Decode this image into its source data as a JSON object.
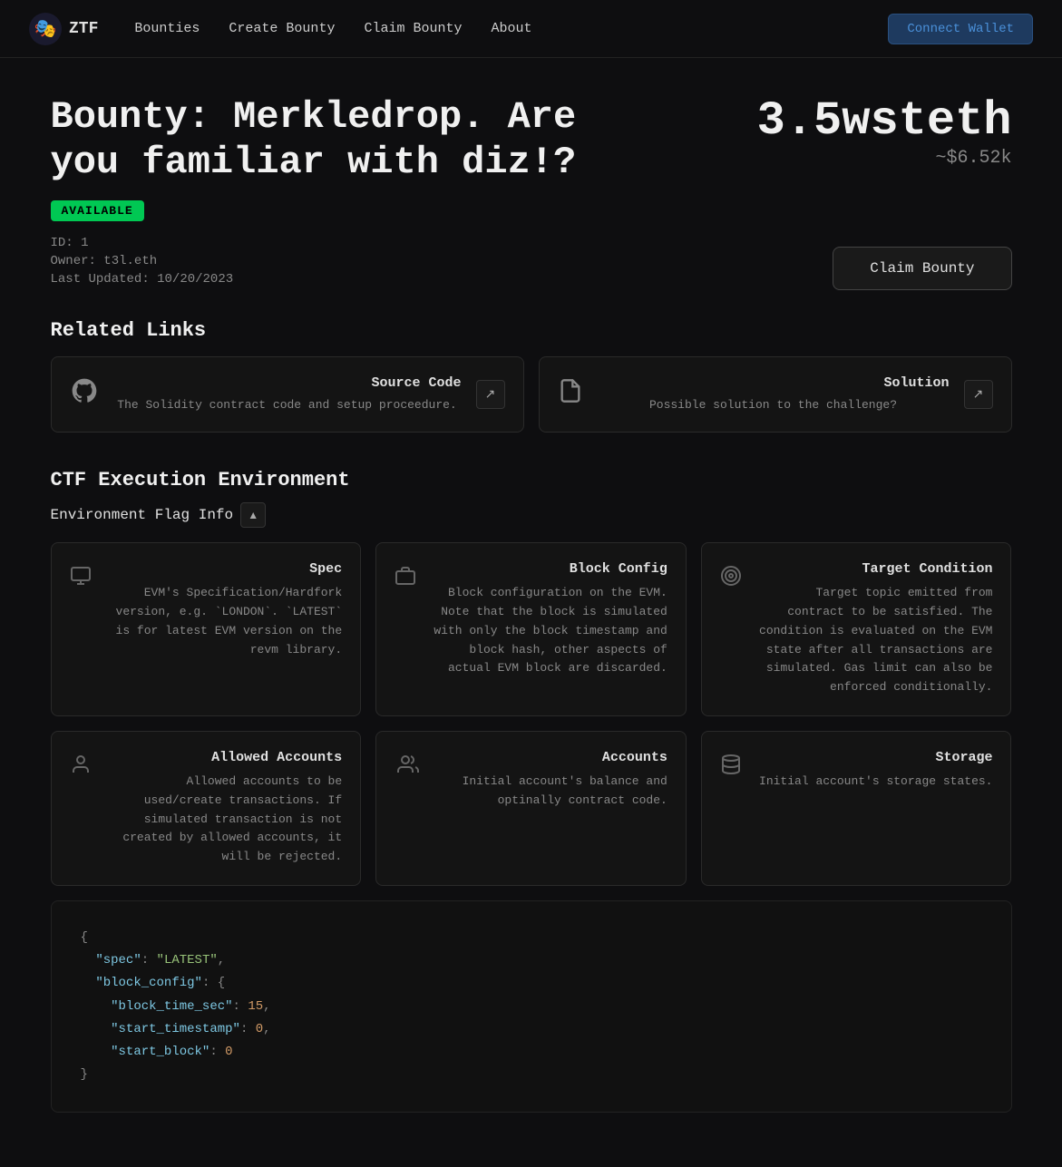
{
  "nav": {
    "logo_text": "ZTF",
    "logo_icon": "🎭",
    "links": [
      {
        "label": "Bounties",
        "id": "bounties"
      },
      {
        "label": "Create Bounty",
        "id": "create-bounty"
      },
      {
        "label": "Claim Bounty",
        "id": "claim-bounty"
      },
      {
        "label": "About",
        "id": "about"
      }
    ],
    "connect_wallet_label": "Connect Wallet"
  },
  "bounty": {
    "title": "Bounty: Merkledrop. Are you familiar with diz!?",
    "status": "AVAILABLE",
    "id": "ID: 1",
    "owner": "Owner: t3l.eth",
    "last_updated": "Last Updated: 10/20/2023",
    "reward_amount": "3.5wsteth",
    "reward_usd": "~$6.52k",
    "claim_button_label": "Claim Bounty"
  },
  "related_links": {
    "section_title": "Related Links",
    "cards": [
      {
        "id": "source-code",
        "icon": "github",
        "title": "Source Code",
        "description": "The Solidity contract code and setup proceedure.",
        "action_icon": "↗"
      },
      {
        "id": "solution",
        "icon": "doc",
        "title": "Solution",
        "description": "Possible solution to the challenge?",
        "action_icon": "↗"
      }
    ]
  },
  "ctf": {
    "section_title": "CTF Execution Environment",
    "env_flag_label": "Environment Flag Info",
    "chevron": "▲",
    "spec_cards": [
      {
        "id": "spec",
        "icon": "monitor",
        "title": "Spec",
        "description": "EVM's Specification/Hardfork version, e.g. `LONDON`. `LATEST` is for latest EVM version on the revm library."
      },
      {
        "id": "block-config",
        "icon": "block",
        "title": "Block Config",
        "description": "Block configuration on the EVM. Note that the block is simulated with only the block timestamp and block hash, other aspects of actual EVM block are discarded."
      },
      {
        "id": "target-condition",
        "icon": "target",
        "title": "Target Condition",
        "description": "Target topic emitted from contract to be satisfied. The condition is evaluated on the EVM state after all transactions are simulated. Gas limit can also be enforced conditionally."
      }
    ],
    "account_cards": [
      {
        "id": "allowed-accounts",
        "icon": "person",
        "title": "Allowed Accounts",
        "description": "Allowed accounts to be used/create transactions. If simulated transaction is not created by allowed accounts, it will be rejected."
      },
      {
        "id": "accounts",
        "icon": "group",
        "title": "Accounts",
        "description": "Initial account's balance and optinally contract code."
      },
      {
        "id": "storage",
        "icon": "storage",
        "title": "Storage",
        "description": "Initial account's storage states."
      }
    ],
    "code": {
      "lines": [
        {
          "type": "punct",
          "text": "{"
        },
        {
          "type": "key-str",
          "key": "\"spec\"",
          "colon": ": ",
          "value": "\"LATEST\"",
          "value_type": "str",
          "comma": ","
        },
        {
          "type": "key-obj",
          "key": "\"block_config\"",
          "colon": ": {"
        },
        {
          "type": "nested-key-num",
          "indent": "    ",
          "key": "\"block_time_sec\"",
          "colon": ": ",
          "value": "15",
          "comma": ","
        },
        {
          "type": "nested-key-num",
          "indent": "    ",
          "key": "\"start_timestamp\"",
          "colon": ": ",
          "value": "0",
          "comma": ","
        },
        {
          "type": "nested-key-num",
          "indent": "    ",
          "key": "\"start_block\"",
          "colon": ": ",
          "value": "0"
        },
        {
          "type": "punct",
          "text": "}"
        }
      ]
    }
  },
  "colors": {
    "available_bg": "#00c853",
    "available_text": "#000000",
    "accent_blue": "#4a90d9"
  }
}
